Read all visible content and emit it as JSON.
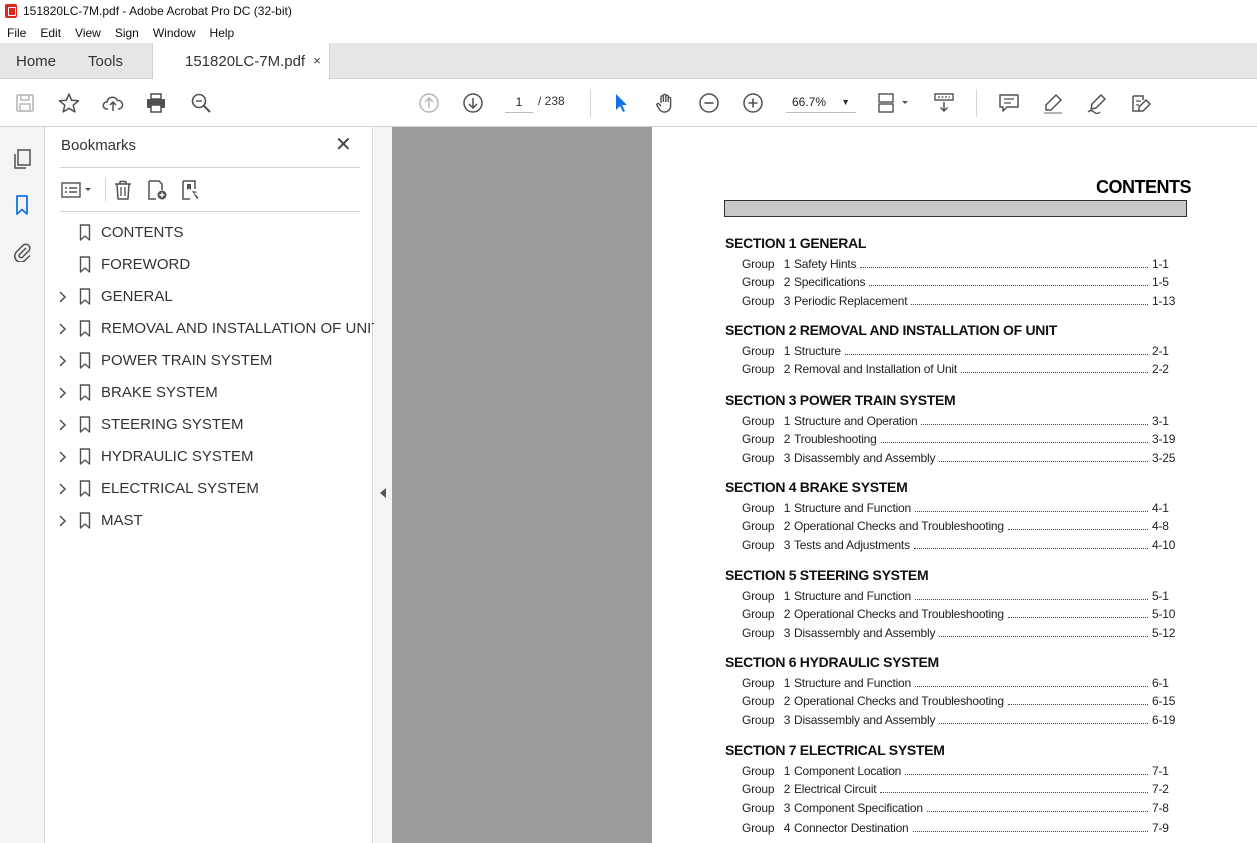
{
  "window": {
    "title": "151820LC-7M.pdf - Adobe Acrobat Pro DC (32-bit)"
  },
  "menu": [
    "File",
    "Edit",
    "View",
    "Sign",
    "Window",
    "Help"
  ],
  "tabs": {
    "home": "Home",
    "tools": "Tools",
    "document": "151820LC-7M.pdf",
    "close": "×"
  },
  "toolbar": {
    "page_current": "1",
    "page_total": "/ 238",
    "zoom": "66.7%",
    "icons": [
      "save-icon",
      "bookmark-star-icon",
      "upload-icon",
      "print-icon",
      "search-zoom-icon",
      "prev-page-icon",
      "next-page-icon",
      "select-cursor-icon",
      "hand-icon",
      "zoom-out-icon",
      "zoom-in-icon",
      "page-fit-icon",
      "scroll-mode-icon",
      "comment-icon",
      "highlight-icon",
      "sign-icon",
      "edit-pdf-icon"
    ]
  },
  "bookmarks": {
    "title": "Bookmarks",
    "close": "✕",
    "items": [
      {
        "label": "CONTENTS",
        "expandable": false
      },
      {
        "label": "FOREWORD",
        "expandable": false
      },
      {
        "label": "GENERAL",
        "expandable": true
      },
      {
        "label": "REMOVAL AND INSTALLATION OF UNIT",
        "expandable": true
      },
      {
        "label": "POWER TRAIN SYSTEM",
        "expandable": true
      },
      {
        "label": "BRAKE SYSTEM",
        "expandable": true
      },
      {
        "label": "STEERING SYSTEM",
        "expandable": true
      },
      {
        "label": "HYDRAULIC SYSTEM",
        "expandable": true
      },
      {
        "label": "ELECTRICAL SYSTEM",
        "expandable": true
      },
      {
        "label": "MAST",
        "expandable": true
      }
    ]
  },
  "document": {
    "title": "CONTENTS",
    "sections": [
      {
        "title": "SECTION 1  GENERAL",
        "groups": [
          {
            "label": "Group   1",
            "name": "Safety Hints",
            "page": "1-1"
          },
          {
            "label": "Group   2",
            "name": "Specifications",
            "page": "1-5"
          },
          {
            "label": "Group   3",
            "name": "Periodic Replacement",
            "page": "1-13"
          }
        ]
      },
      {
        "title": "SECTION 2  REMOVAL AND INSTALLATION OF UNIT",
        "groups": [
          {
            "label": "Group   1",
            "name": "Structure",
            "page": "2-1"
          },
          {
            "label": "Group   2",
            "name": "Removal and Installation of Unit",
            "page": "2-2"
          }
        ]
      },
      {
        "title": "SECTION 3  POWER TRAIN SYSTEM",
        "groups": [
          {
            "label": "Group   1",
            "name": "Structure and Operation",
            "page": "3-1"
          },
          {
            "label": "Group   2",
            "name": "Troubleshooting",
            "page": "3-19"
          },
          {
            "label": "Group   3",
            "name": "Disassembly and Assembly",
            "page": "3-25"
          }
        ]
      },
      {
        "title": "SECTION 4  BRAKE SYSTEM",
        "groups": [
          {
            "label": "Group   1",
            "name": "Structure and Function",
            "page": "4-1"
          },
          {
            "label": "Group   2",
            "name": "Operational Checks and Troubleshooting",
            "page": "4-8"
          },
          {
            "label": "Group   3",
            "name": "Tests and Adjustments",
            "page": "4-10"
          }
        ]
      },
      {
        "title": "SECTION 5  STEERING SYSTEM",
        "groups": [
          {
            "label": "Group   1",
            "name": "Structure and Function",
            "page": "5-1"
          },
          {
            "label": "Group   2",
            "name": "Operational Checks and Troubleshooting",
            "page": "5-10"
          },
          {
            "label": "Group   3",
            "name": "Disassembly and Assembly",
            "page": "5-12"
          }
        ]
      },
      {
        "title": "SECTION 6  HYDRAULIC SYSTEM",
        "groups": [
          {
            "label": "Group   1",
            "name": "Structure and Function",
            "page": "6-1"
          },
          {
            "label": "Group   2",
            "name": "Operational Checks and Troubleshooting",
            "page": "6-15"
          },
          {
            "label": "Group   3",
            "name": "Disassembly and Assembly",
            "page": "6-19"
          }
        ]
      },
      {
        "title": "SECTION 7  ELECTRICAL SYSTEM",
        "groups": [
          {
            "label": "Group   1",
            "name": "Component Location",
            "page": "7-1"
          },
          {
            "label": "Group   2",
            "name": "Electrical Circuit",
            "page": "7-2"
          },
          {
            "label": "Group   3",
            "name": "Component Specification",
            "page": "7-8"
          },
          {
            "label": "Group   4",
            "name": "Connector Destination",
            "page": "7-9"
          }
        ]
      }
    ]
  },
  "colors": {
    "accent": "#1473e6",
    "pdf_red": "#e0261d",
    "gutter": "#9b9b9b"
  }
}
